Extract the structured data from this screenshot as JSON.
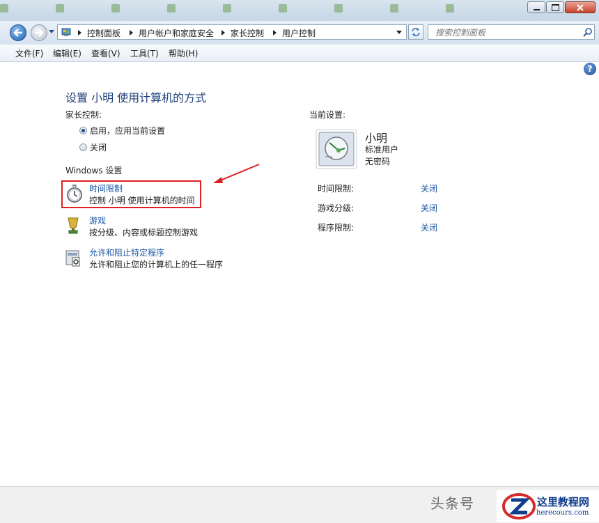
{
  "taskbar": {
    "items": [
      "",
      "",
      "",
      "",
      "",
      "",
      "",
      "",
      ""
    ]
  },
  "address": {
    "crumbs": [
      "控制面板",
      "用户帐户和家庭安全",
      "家长控制",
      "用户控制"
    ]
  },
  "search": {
    "placeholder": "搜索控制面板"
  },
  "menu": {
    "file": "文件(F)",
    "edit": "编辑(E)",
    "view": "查看(V)",
    "tools": "工具(T)",
    "help": "帮助(H)"
  },
  "help_icon": "?",
  "page": {
    "title": "设置 小明 使用计算机的方式",
    "parental_label": "家长控制:",
    "radio_on": "启用，应用当前设置",
    "radio_off": "关闭",
    "windows_settings": "Windows 设置",
    "options": [
      {
        "icon": "stopwatch-icon",
        "title": "时间限制",
        "desc": "控制 小明 使用计算机的时间"
      },
      {
        "icon": "trophy-icon",
        "title": "游戏",
        "desc": "按分级、内容或标题控制游戏"
      },
      {
        "icon": "program-icon",
        "title": "允许和阻止特定程序",
        "desc": "允许和阻止您的计算机上的任一程序"
      }
    ]
  },
  "current": {
    "label": "当前设置:",
    "user_name": "小明",
    "account_type": "标准用户",
    "password": "无密码",
    "rows": [
      {
        "key": "时间限制:",
        "value": "关闭"
      },
      {
        "key": "游戏分级:",
        "value": "关闭"
      },
      {
        "key": "程序限制:",
        "value": "关闭"
      }
    ]
  },
  "watermark": {
    "text": "头条号",
    "brand": "这里教程网",
    "url": "herecours.com"
  },
  "colors": {
    "link": "#1a55a6",
    "title": "#1e3f7a",
    "highlight_box": "#e02020",
    "arrow": "#e02020"
  }
}
